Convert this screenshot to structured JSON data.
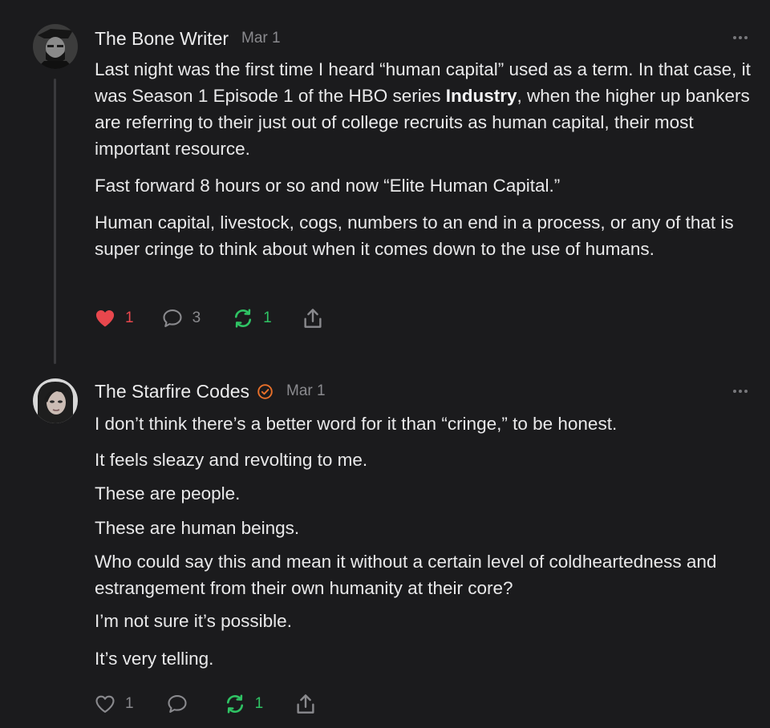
{
  "comments": [
    {
      "author": "The Bone Writer",
      "date": "Mar 1",
      "paragraphs": {
        "p1_before": "Last night was the first time I heard “human capital” used as a term. In that case, it was Season 1 Episode 1 of the HBO series ",
        "p1_bold": "Industry",
        "p1_after": ", when the higher up bankers are referring to their just out of college recruits as human capital, their most important resource.",
        "p2": "Fast forward 8 hours or so and now “Elite Human Capital.”",
        "p3": "Human capital, livestock, cogs, numbers to an end in a process, or any of that is super cringe to think about when it comes down to the use of humans."
      },
      "actions": {
        "likes": "1",
        "liked": true,
        "replies": "3",
        "restacks": "1"
      },
      "icons": [
        "heart-filled-icon",
        "comment-icon",
        "restack-icon",
        "share-icon",
        "more-icon"
      ]
    },
    {
      "author": "The Starfire Codes",
      "verified": true,
      "date": "Mar 1",
      "paragraphs": [
        "I don’t think there’s a better word for it than “cringe,” to be honest.",
        "It feels sleazy and revolting to me.",
        "These are people.",
        "These are human beings.",
        "Who could say this and mean it without a certain level of coldheartedness and estrangement from their own humanity at their core?",
        "I’m not sure it’s possible.",
        "It’s very telling."
      ],
      "actions": {
        "likes": "1",
        "liked": false,
        "replies": "",
        "restacks": "1"
      },
      "icons": [
        "heart-outline-icon",
        "comment-icon",
        "restack-icon",
        "share-icon",
        "more-icon",
        "verified-badge-icon"
      ]
    }
  ],
  "colors": {
    "background": "#1b1b1d",
    "text": "#e9e9ea",
    "muted": "#8a8a8e",
    "like_red": "#e8474d",
    "restack_green": "#2fc364",
    "badge_orange": "#e8702a",
    "thread_line": "#3a3a3d"
  }
}
